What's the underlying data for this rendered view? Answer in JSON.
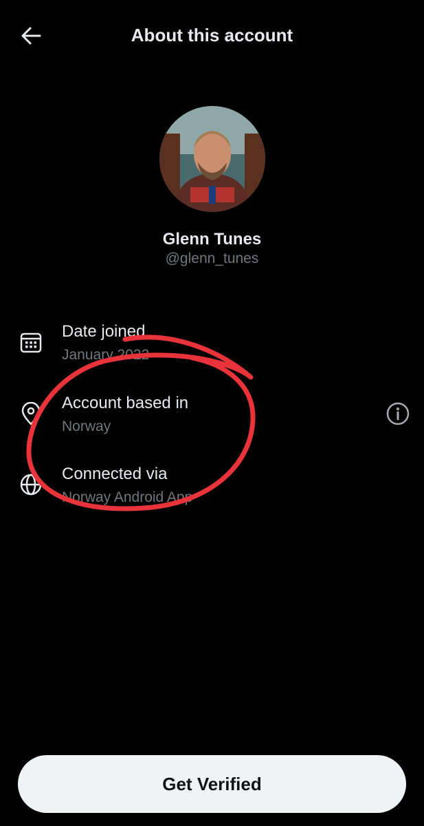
{
  "header": {
    "title": "About this account",
    "back_icon": "arrow-left-icon"
  },
  "profile": {
    "name": "Glenn Tunes",
    "handle": "@glenn_tunes"
  },
  "details": [
    {
      "icon": "calendar-icon",
      "label": "Date joined",
      "value": "January 2022"
    },
    {
      "icon": "location-pin-icon",
      "label": "Account based in",
      "value": "Norway"
    },
    {
      "icon": "globe-icon",
      "label": "Connected via",
      "value": "Norway Android App"
    }
  ],
  "info_icon": "info-icon",
  "cta": {
    "label": "Get Verified"
  },
  "colors": {
    "background": "#000000",
    "text": "#e7e9ea",
    "secondary_text": "#71767b",
    "button_bg": "#eff3f4",
    "annotation": "#e8333b"
  }
}
